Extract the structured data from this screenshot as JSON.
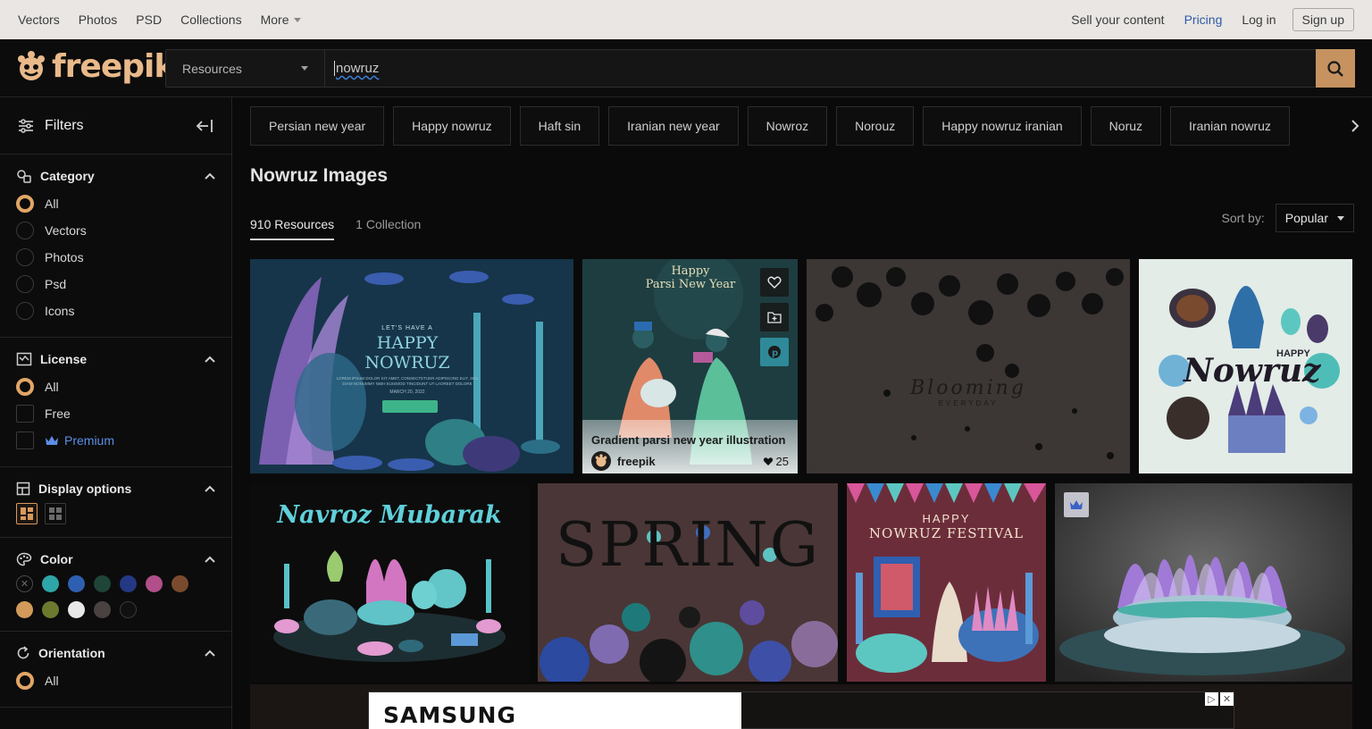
{
  "topbar": {
    "nav": [
      "Vectors",
      "Photos",
      "PSD",
      "Collections"
    ],
    "more_label": "More",
    "sell_label": "Sell your content",
    "pricing_label": "Pricing",
    "login_label": "Log in",
    "signup_label": "Sign up"
  },
  "header": {
    "logo_text": "freepik",
    "search_scope": "Resources",
    "search_query": "nowruz"
  },
  "sidebar": {
    "filters_title": "Filters",
    "category": {
      "title": "Category",
      "options": [
        "All",
        "Vectors",
        "Photos",
        "Psd",
        "Icons"
      ],
      "selected": "All"
    },
    "license": {
      "title": "License",
      "options": [
        "All",
        "Free",
        "Premium"
      ],
      "selected": "All"
    },
    "display": {
      "title": "Display options"
    },
    "color": {
      "title": "Color",
      "swatches": [
        "none",
        "#2ea6a8",
        "#2f5fb0",
        "#1f4438",
        "#243884",
        "#b04f8a",
        "#7a4a2e",
        "#d29a5a",
        "#6c7a2e",
        "#e8e8e8",
        "#4a4240",
        "#101010"
      ]
    },
    "orientation": {
      "title": "Orientation",
      "options": [
        "All"
      ],
      "selected": "All"
    }
  },
  "main": {
    "tags": [
      "Persian new year",
      "Happy nowruz",
      "Haft sin",
      "Iranian new year",
      "Nowroz",
      "Norouz",
      "Happy nowruz iranian",
      "Noruz",
      "Iranian nowruz"
    ],
    "title": "Nowruz Images",
    "tabs": [
      "910 Resources",
      "1 Collection"
    ],
    "sort_label": "Sort by:",
    "sort_value": "Popular",
    "cards": {
      "card1": {
        "heading": "LET'S HAVE A",
        "title": "HAPPY NOWRUZ",
        "body": "LOREM IPSUM DOLOR SIT AMET, CONSECTETUER ADIPISCING ELIT, SED DIAM NONUMMY NIBH EUISMOD TINCIDUNT UT LAOREET DOLORE",
        "date": "MARCH 20, 2022",
        "button": "CHECK IT OUT"
      },
      "card2": {
        "art_line1": "Happy",
        "art_line2": "Parsi New Year",
        "title": "Gradient parsi new year illustration",
        "author": "freepik",
        "likes": "25"
      },
      "card3": {
        "line1": "Blooming",
        "line2": "EVERYDAY"
      },
      "card4": {
        "small": "HAPPY",
        "big": "Nowruz"
      },
      "card5": {
        "title": "Navroz Mubarak"
      },
      "card6": {
        "title": "SPRING"
      },
      "card7": {
        "small": "HAPPY",
        "big": "NOWRUZ FESTIVAL"
      }
    },
    "ad": {
      "brand": "SAMSUNG"
    }
  }
}
